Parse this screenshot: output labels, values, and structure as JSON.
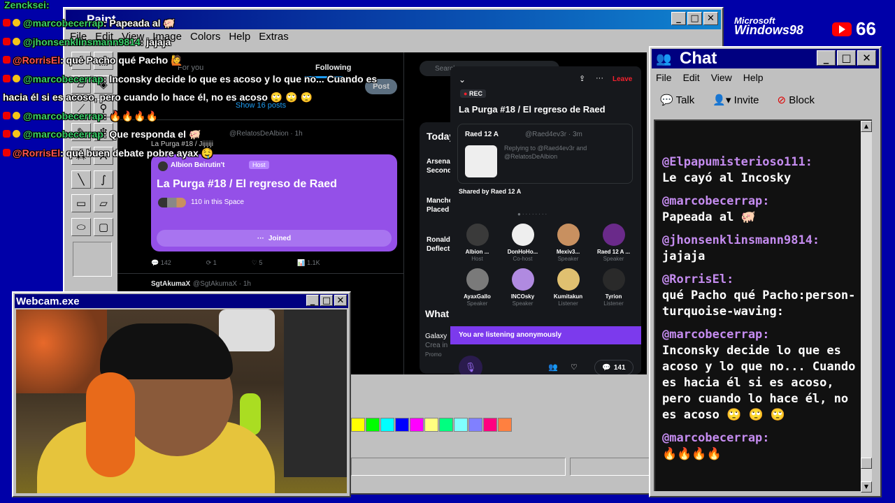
{
  "overlay": {
    "top_user": "Zencksei",
    "messages": [
      {
        "user": "@marcobecerrap",
        "text": ": Papeada al 🐖",
        "color": "green"
      },
      {
        "user": "@jhonsenklinsmann9814",
        "text": ": jajaja",
        "color": "green"
      },
      {
        "user": "@RorrisEl",
        "text": ": qué Pacho qué Pacho 🙋",
        "color": "red"
      },
      {
        "user": "@marcobecerrap",
        "text": ": Inconsky decide lo que es acoso y lo que no... Cuando es",
        "color": "green"
      },
      {
        "user": "",
        "text": "hacia él si es acoso, pero cuando lo hace él, no es acoso 🙄 🙄 🙄",
        "color": "none"
      },
      {
        "user": "@marcobecerrap",
        "text": ": 🔥🔥🔥🔥",
        "color": "green"
      },
      {
        "user": "@marcobecerrap",
        "text": ": Que responda el 🐖",
        "color": "green"
      },
      {
        "user": "@RorrisEl",
        "text": ": qué buen debate pobre ayax 🤤",
        "color": "red"
      }
    ]
  },
  "branding": {
    "microsoft": "Microsoft",
    "windows": "Windows98",
    "viewer_count": "66"
  },
  "paint": {
    "title": "Paint",
    "menu": [
      "File",
      "Edit",
      "View",
      "Image",
      "Colors",
      "Help",
      "Extras"
    ],
    "palette": [
      "#ffff00",
      "#00ff00",
      "#00ffff",
      "#0000ff",
      "#ff00ff",
      "#ffff80",
      "#00ff80",
      "#80ffff",
      "#8080ff",
      "#ff0080",
      "#ff8040"
    ]
  },
  "twitter": {
    "tabs": [
      "For you",
      "Following"
    ],
    "post_button": "Post",
    "show_posts": "Show 16 posts",
    "search_placeholder": "Search",
    "tweet1": {
      "handle": "@RelatosDeAlbion · 1h",
      "text": "La Purga #18 / Jijijiji"
    },
    "space_card": {
      "host": "Albion Beirutin't",
      "host_tag": "Host",
      "title": "La Purga #18 / El regreso de Raed",
      "listeners": "110 in this Space",
      "joined": "Joined"
    },
    "tweet1_stats": [
      "142",
      "1",
      "5",
      "1.1K"
    ],
    "tweet2": {
      "name": "SgtAkumaX",
      "handle": "@SgtAkumaX · 1h"
    },
    "sidebar": {
      "today": "Today",
      "items": [
        "Arsena",
        "Second",
        "Manche",
        "Placed",
        "Ronald",
        "Deflect"
      ],
      "whats": "What",
      "galaxy": "Galaxy",
      "crea": "Crea in",
      "promo": "Promo"
    }
  },
  "space": {
    "rec": "REC",
    "leave": "Leave",
    "title": "La Purga #18 / El regreso de Raed",
    "pinned_user": "Raed 12 A",
    "pinned_handle": "@Raed4ev3r · 3m",
    "pinned_reply": "Replying to @Raed4ev3r and @RelatosDeAlbion",
    "shared_by": "Shared by Raed 12 A",
    "speakers": [
      {
        "name": "Albion ...",
        "role": "Host",
        "color": "#3a3a3a"
      },
      {
        "name": "DonHoHo...",
        "role": "Co-host",
        "color": "#eeeeee"
      },
      {
        "name": "Mexiv3...",
        "role": "Speaker",
        "color": "#c89060"
      },
      {
        "name": "Raed 12 A ...",
        "role": "Speaker",
        "color": "#6a2a8a"
      },
      {
        "name": "AyaxGallo",
        "role": "Speaker",
        "color": "#7a7a7a"
      },
      {
        "name": "INCOsky",
        "role": "Speaker",
        "color": "#b08ae0"
      },
      {
        "name": "Kumitakun",
        "role": "Listener",
        "color": "#e0c070"
      },
      {
        "name": "Tyrion",
        "role": "Listener",
        "color": "#2a2a2a"
      }
    ],
    "anon": "You are listening anonymously",
    "reply_count": "141"
  },
  "webcam": {
    "title": "Webcam.exe"
  },
  "chat": {
    "title": "Chat",
    "menu": [
      "File",
      "Edit",
      "View",
      "Help"
    ],
    "tools": [
      "Talk",
      "Invite",
      "Block"
    ],
    "log": [
      {
        "user": "@Elpapumisterioso111:",
        "msg": "Le cayó al Incosky"
      },
      {
        "user": "@marcobecerrap:",
        "msg": "Papeada al 🐖"
      },
      {
        "user": "@jhonsenklinsmann9814:",
        "msg": "jajaja"
      },
      {
        "user": "@RorrisEl:",
        "msg": "qué Pacho qué Pacho:person-turquoise-waving:"
      },
      {
        "user": "@marcobecerrap:",
        "msg": "Inconsky decide lo que es acoso y lo que no... Cuando es hacia él si es acoso, pero cuando lo hace él, no es acoso 🙄 🙄 🙄"
      },
      {
        "user": "@marcobecerrap:",
        "msg": "🔥🔥🔥🔥"
      }
    ]
  }
}
